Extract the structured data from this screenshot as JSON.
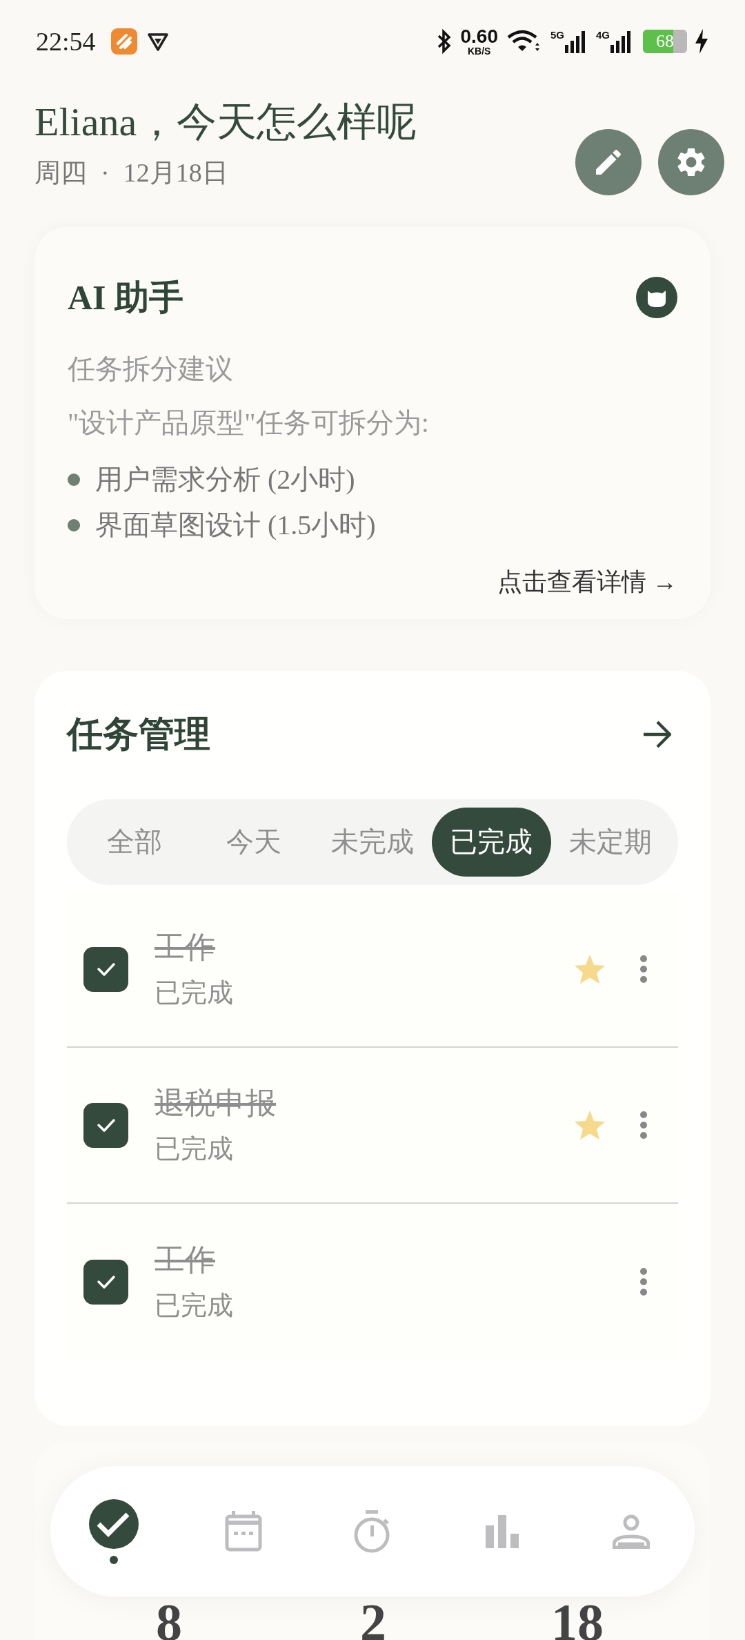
{
  "status_bar": {
    "time": "22:54",
    "net_speed": "0.60",
    "net_unit": "KB/S",
    "signal_1": "5G",
    "signal_2": "4G",
    "battery": "68"
  },
  "header": {
    "greeting": "Eliana，今天怎么样呢",
    "weekday": "周四",
    "separator": "·",
    "date": "12月18日"
  },
  "ai_card": {
    "title": "AI 助手",
    "subtitle": "任务拆分建议",
    "intro": "\"设计产品原型\"任务可拆分为:",
    "bullets": [
      "用户需求分析 (2小时)",
      "界面草图设计 (1.5小时)"
    ],
    "link": "点击查看详情 →"
  },
  "tasks": {
    "title": "任务管理",
    "tabs": [
      {
        "label": "全部",
        "selected": false
      },
      {
        "label": "今天",
        "selected": false
      },
      {
        "label": "未完成",
        "selected": false
      },
      {
        "label": "已完成",
        "selected": true
      },
      {
        "label": "未定期",
        "selected": false
      }
    ],
    "items": [
      {
        "title": "工作",
        "status": "已完成",
        "checked": true,
        "starred": true
      },
      {
        "title": "退税申报",
        "status": "已完成",
        "checked": true,
        "starred": true
      },
      {
        "title": "工作",
        "status": "已完成",
        "checked": true,
        "starred": false
      }
    ]
  },
  "stats": {
    "values": [
      "8",
      "2",
      "18"
    ]
  },
  "nav": {
    "items": [
      {
        "kind": "tasks",
        "selected": true
      },
      {
        "kind": "calendar",
        "selected": false
      },
      {
        "kind": "timer",
        "selected": false
      },
      {
        "kind": "stats",
        "selected": false
      },
      {
        "kind": "profile",
        "selected": false
      }
    ]
  }
}
